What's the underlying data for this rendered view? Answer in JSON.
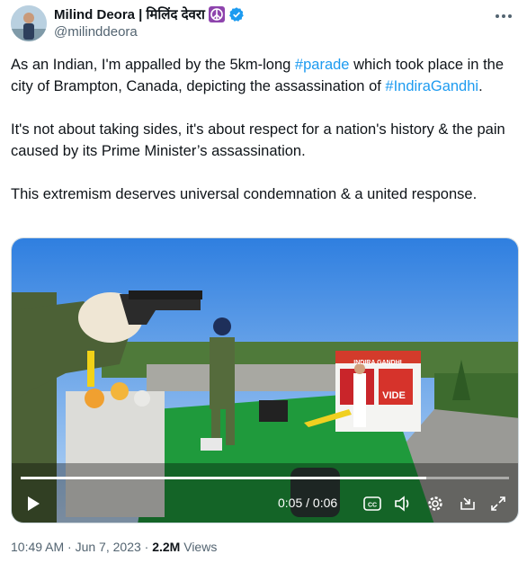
{
  "author": {
    "display_name": "Milind Deora | मिलिंद देवरा",
    "handle": "@milinddeora",
    "badge_icon": "peace-symbol-icon",
    "verified_icon": "verified-badge-icon",
    "verified_color": "#1d9bf0"
  },
  "tweet": {
    "p1_a": "As an Indian, I'm appalled by the 5km-long ",
    "p1_tag1": "#parade",
    "p1_b": " which took place in the city of Brampton, Canada, depicting the assassination of ",
    "p1_tag2": "#IndiraGandhi",
    "p1_c": ".",
    "p2": "It's not about taking sides, it's about respect for a nation's history & the pain caused by its Prime Minister’s assassination.",
    "p3": "This extremism deserves universal condemnation & a united response."
  },
  "video": {
    "timecode": "0:05 / 0:06",
    "progress": 0.83,
    "controls": [
      "play-icon",
      "captions-icon",
      "volume-icon",
      "settings-icon",
      "pip-icon",
      "fullscreen-icon"
    ],
    "float_labels": [
      "INDIRA GANDHI",
      "VIDE"
    ]
  },
  "meta": {
    "time_date": "10:49 AM · Jun 7, 2023 · ",
    "views_count": "2.2M",
    "views_label": " Views"
  },
  "colors": {
    "link": "#1d9bf0",
    "secondary_text": "#536471"
  }
}
